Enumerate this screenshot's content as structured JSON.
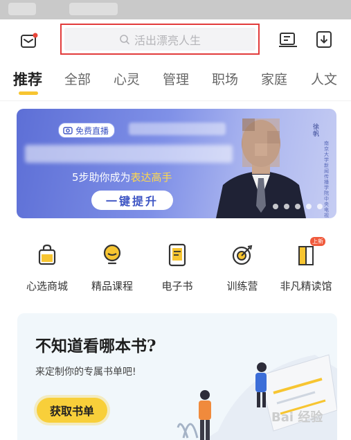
{
  "search": {
    "placeholder": "活出漂亮人生"
  },
  "tabs": [
    {
      "label": "推荐",
      "active": true
    },
    {
      "label": "全部"
    },
    {
      "label": "心灵"
    },
    {
      "label": "管理"
    },
    {
      "label": "职场"
    },
    {
      "label": "家庭"
    },
    {
      "label": "人文"
    }
  ],
  "banner": {
    "badge": "免费直播",
    "subtitle_prefix": "5步助你成为",
    "subtitle_highlight": "表达高手",
    "cta": "一键提升",
    "vertical_name": "徐帆",
    "vertical_desc": "南京大学新闻传播学院中央电视台评论员"
  },
  "grid": [
    {
      "label": "心选商城",
      "icon": "shopping-bag-icon"
    },
    {
      "label": "精品课程",
      "icon": "lightbulb-icon"
    },
    {
      "label": "电子书",
      "icon": "ebook-icon"
    },
    {
      "label": "训练营",
      "icon": "target-icon"
    },
    {
      "label": "非凡精读馆",
      "icon": "book-stack-icon",
      "badge": "上新"
    }
  ],
  "promo": {
    "title": "不知道看哪本书?",
    "desc": "来定制你的专属书单吧!",
    "button": "获取书单"
  },
  "watermark": "Bai 经验",
  "colors": {
    "accent": "#f7c531",
    "highlight_border": "#e23b3b",
    "banner": "#6b7ee0"
  }
}
